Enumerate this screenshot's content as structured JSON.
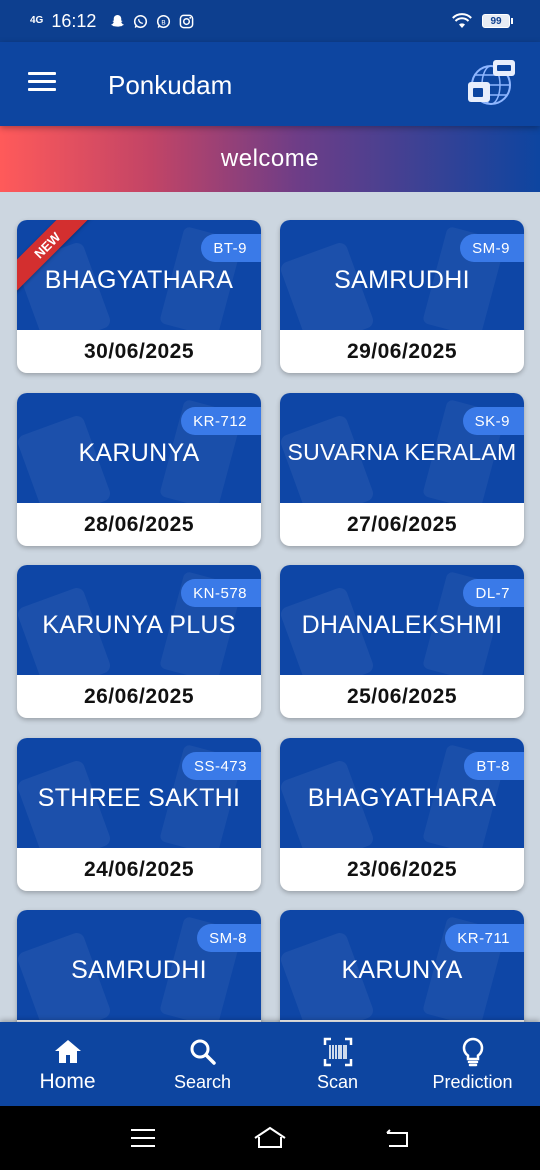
{
  "status_bar": {
    "network": "4G",
    "time": "16:12",
    "battery": "99",
    "notification_icons": [
      "snapchat-icon",
      "whatsapp-icon",
      "whatsapp-business-icon",
      "instagram-icon"
    ]
  },
  "app_bar": {
    "title": "Ponkudam",
    "menu_icon": "hamburger-menu-icon",
    "language_icon": "language-globe-icon"
  },
  "banner": {
    "text": "welcome"
  },
  "cards": [
    {
      "name": "BHAGYATHARA",
      "code": "BT-9",
      "date": "30/06/2025",
      "badge": "NEW"
    },
    {
      "name": "SAMRUDHI",
      "code": "SM-9",
      "date": "29/06/2025"
    },
    {
      "name": "KARUNYA",
      "code": "KR-712",
      "date": "28/06/2025"
    },
    {
      "name": "SUVARNA KERALAM",
      "code": "SK-9",
      "date": "27/06/2025"
    },
    {
      "name": "KARUNYA PLUS",
      "code": "KN-578",
      "date": "26/06/2025"
    },
    {
      "name": "DHANALEKSHMI",
      "code": "DL-7",
      "date": "25/06/2025"
    },
    {
      "name": "STHREE SAKTHI",
      "code": "SS-473",
      "date": "24/06/2025"
    },
    {
      "name": "BHAGYATHARA",
      "code": "BT-8",
      "date": "23/06/2025"
    },
    {
      "name": "SAMRUDHI",
      "code": "SM-8",
      "date": ""
    },
    {
      "name": "KARUNYA",
      "code": "KR-711",
      "date": ""
    }
  ],
  "bottom_nav": [
    {
      "label": "Home",
      "icon": "home-icon",
      "active": true
    },
    {
      "label": "Search",
      "icon": "search-icon"
    },
    {
      "label": "Scan",
      "icon": "barcode-scan-icon"
    },
    {
      "label": "Prediction",
      "icon": "lightbulb-icon"
    }
  ],
  "system_nav": [
    "recents-icon",
    "home-outline-icon",
    "back-icon"
  ],
  "colors": {
    "primary": "#0d45a0",
    "card_blue": "#0e46a6",
    "code_pill": "#3a7ae8",
    "background": "#ccd6e0",
    "ribbon": "#d32f2f"
  }
}
